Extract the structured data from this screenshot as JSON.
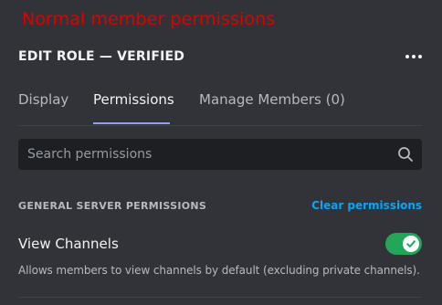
{
  "annotation": "Normal member permissions",
  "header": {
    "title": "EDIT ROLE — VERIFIED",
    "more_icon": "more-horizontal-icon"
  },
  "tabs": [
    {
      "label": "Display",
      "active": false
    },
    {
      "label": "Permissions",
      "active": true
    },
    {
      "label": "Manage Members (0)",
      "active": false
    }
  ],
  "search": {
    "placeholder": "Search permissions",
    "value": "",
    "icon": "search-icon"
  },
  "section": {
    "title": "GENERAL SERVER PERMISSIONS",
    "clear_label": "Clear permissions"
  },
  "permissions": [
    {
      "label": "View Channels",
      "description": "Allows members to view channels by default (excluding private channels).",
      "enabled": true
    }
  ],
  "colors": {
    "background": "#313338",
    "annotation": "#e00000",
    "tab_underline": "#949cf7",
    "link": "#00a8fc",
    "toggle_on": "#23a55a"
  }
}
